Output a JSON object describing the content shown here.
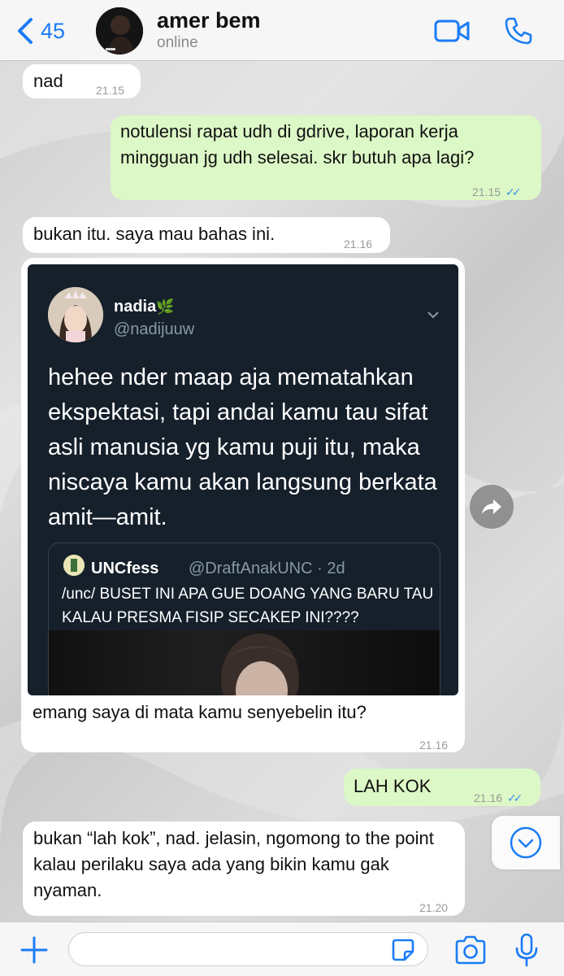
{
  "header": {
    "back_count": "45",
    "contact_name": "amer bem",
    "status": "online"
  },
  "messages": [
    {
      "type": "incoming",
      "text": "nad",
      "time": "21.15"
    },
    {
      "type": "outgoing",
      "text": "notulensi rapat udh di gdrive, laporan kerja mingguan jg udh selesai. skr butuh apa lagi?",
      "time": "21.15"
    },
    {
      "type": "incoming",
      "text": "bukan itu. saya mau bahas ini.",
      "time": "21.16"
    },
    {
      "type": "incoming",
      "text": "emang saya di mata kamu senyebelin itu?",
      "time": "21.16"
    },
    {
      "type": "outgoing",
      "text": "LAH KOK",
      "time": "21.16"
    },
    {
      "type": "incoming",
      "text": "bukan “lah kok”, nad. jelasin, ngomong to the point kalau perilaku saya ada yang bikin kamu gak nyaman.",
      "time": "21.20"
    }
  ],
  "tweet": {
    "name": "nadia",
    "name_emoji": "🌿",
    "handle": "@nadijuuw",
    "text": "hehee nder maap aja mematahkan ekspektasi, tapi andai kamu tau sifat asli manusia yg kamu puji itu,  maka niscaya kamu akan langsung berkata amit—amit.",
    "quote": {
      "name": "UNCfess",
      "handle_time": "@DraftAnakUNC · 2d",
      "text": "/unc/ BUSET INI APA GUE DOANG YANG BARU TAU KALAU PRESMA FISIP SECAKEP INI????"
    }
  },
  "input": {
    "placeholder": "",
    "value": ""
  },
  "colors": {
    "accent": "#1a7cf5",
    "outgoing_bubble": "#dcf8c6",
    "incoming_bubble": "#ffffff",
    "read_ticks": "#3b93e0",
    "tweet_bg": "#15202b"
  }
}
